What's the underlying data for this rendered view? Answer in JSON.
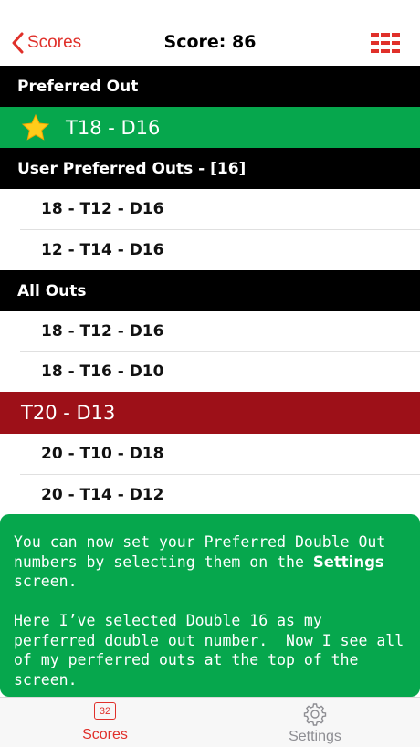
{
  "nav": {
    "back_label": "Scores",
    "title": "Score: 86"
  },
  "preferred_out": {
    "header": "Preferred Out",
    "value": "T18 - D16"
  },
  "user_preferred": {
    "header": "User Preferred Outs - [16]",
    "items": [
      "18 - T12 - D16",
      "12 - T14 - D16"
    ]
  },
  "all_outs": {
    "header": "All Outs",
    "items": [
      "18 - T12 - D16",
      "18 - T16 - D10"
    ]
  },
  "alt_out": {
    "value": "T20 - D13",
    "items": [
      "20 - T10 - D18",
      "20 - T14 - D12"
    ]
  },
  "tooltip": {
    "line1_pre": "You can now set your Preferred Double Out numbers by selecting them on the",
    "line1_bold": "Settings",
    "line1_post": "screen.",
    "line2": "Here I’ve selected Double 16 as my perferred double out number.  Now I see all of my perferred outs at the top of the screen."
  },
  "tabs": {
    "scores_label": "Scores",
    "scores_badge": "32",
    "settings_label": "Settings"
  },
  "colors": {
    "accent_red": "#e0302a",
    "green": "#06a74d",
    "dark_red": "#9d1018"
  }
}
